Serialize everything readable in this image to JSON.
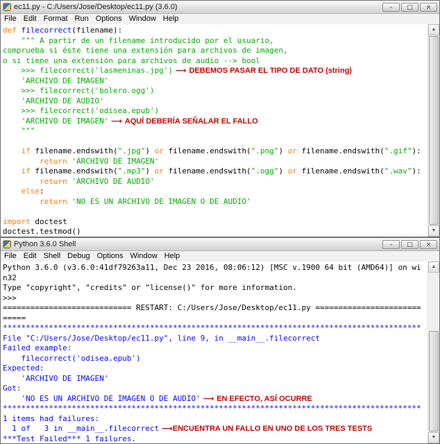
{
  "colors": {
    "keyword": "#FF7700",
    "definition": "#0000FF",
    "string": "#00AA00",
    "plain": "#000000",
    "console": "#000000",
    "stdout": "#0000FF",
    "annotation": "#C00000"
  },
  "chrome": {
    "minimize": "–",
    "maximize": "□",
    "close": "×",
    "scroll_up": "▲",
    "scroll_down": "▼"
  },
  "editor": {
    "title": "ec11.py - C:/Users/Jose/Desktop/ec11.py (3.6.0)",
    "menus": [
      "File",
      "Edit",
      "Format",
      "Run",
      "Options",
      "Window",
      "Help"
    ],
    "lines": [
      [
        {
          "t": "def ",
          "c": "kw"
        },
        {
          "t": "filecorrect",
          "c": "fn"
        },
        {
          "t": "(filename):",
          "c": "pl"
        }
      ],
      [
        {
          "t": "    \"\"\" A partir de un filename introducido por el usuario,",
          "c": "str"
        }
      ],
      [
        {
          "t": "comprueba si éste tiene una extensión para archivos de imagen,",
          "c": "str"
        }
      ],
      [
        {
          "t": "o si tiene una extensión para archivos de audio --> bool",
          "c": "str"
        }
      ],
      [
        {
          "t": "    >>> filecorrect('lasmeninas.jpg')",
          "c": "str"
        },
        {
          "t": " ⟶ ",
          "c": "arr"
        },
        {
          "t": "DEBEMOS PASAR EL TIPO DE DATO (string)",
          "c": "ann"
        }
      ],
      [
        {
          "t": "    'ARCHIVO DE IMAGEN'",
          "c": "str"
        }
      ],
      [
        {
          "t": "    >>> filecorrect('bolero.ogg')",
          "c": "str"
        }
      ],
      [
        {
          "t": "    'ARCHIVO DE AUDIO'",
          "c": "str"
        }
      ],
      [
        {
          "t": "    >>> filecorrect('odisea.epub')",
          "c": "str"
        }
      ],
      [
        {
          "t": "    'ARCHIVO DE IMAGEN'",
          "c": "str"
        },
        {
          "t": " ⟶ ",
          "c": "arr"
        },
        {
          "t": "AQUÍ DEBERÍA SEÑALAR EL FALLO",
          "c": "ann"
        }
      ],
      [
        {
          "t": "    \"\"\"",
          "c": "str"
        }
      ],
      [
        {
          "t": "",
          "c": "pl"
        }
      ],
      [
        {
          "t": "    ",
          "c": "pl"
        },
        {
          "t": "if",
          "c": "kw"
        },
        {
          "t": " filename.endswith(",
          "c": "pl"
        },
        {
          "t": "\".jpg\"",
          "c": "str"
        },
        {
          "t": ") ",
          "c": "pl"
        },
        {
          "t": "or",
          "c": "kw"
        },
        {
          "t": " filename.endswith(",
          "c": "pl"
        },
        {
          "t": "\".png\"",
          "c": "str"
        },
        {
          "t": ") ",
          "c": "pl"
        },
        {
          "t": "or",
          "c": "kw"
        },
        {
          "t": " filename.endswith(",
          "c": "pl"
        },
        {
          "t": "\".gif\"",
          "c": "str"
        },
        {
          "t": "):",
          "c": "pl"
        }
      ],
      [
        {
          "t": "        ",
          "c": "pl"
        },
        {
          "t": "return",
          "c": "kw"
        },
        {
          "t": " ",
          "c": "pl"
        },
        {
          "t": "'ARCHIVO DE IMAGEN'",
          "c": "str"
        }
      ],
      [
        {
          "t": "    ",
          "c": "pl"
        },
        {
          "t": "if",
          "c": "kw"
        },
        {
          "t": " filename.endswith(",
          "c": "pl"
        },
        {
          "t": "\".mp3\"",
          "c": "str"
        },
        {
          "t": ") ",
          "c": "pl"
        },
        {
          "t": "or",
          "c": "kw"
        },
        {
          "t": " filename.endswith(",
          "c": "pl"
        },
        {
          "t": "\".ogg\"",
          "c": "str"
        },
        {
          "t": ") ",
          "c": "pl"
        },
        {
          "t": "or",
          "c": "kw"
        },
        {
          "t": " filename.endswith(",
          "c": "pl"
        },
        {
          "t": "\".wav\"",
          "c": "str"
        },
        {
          "t": "):",
          "c": "pl"
        }
      ],
      [
        {
          "t": "        ",
          "c": "pl"
        },
        {
          "t": "return",
          "c": "kw"
        },
        {
          "t": " ",
          "c": "pl"
        },
        {
          "t": "'ARCHIVO DE AUDIO'",
          "c": "str"
        }
      ],
      [
        {
          "t": "    ",
          "c": "pl"
        },
        {
          "t": "else",
          "c": "kw"
        },
        {
          "t": ":",
          "c": "pl"
        }
      ],
      [
        {
          "t": "        ",
          "c": "pl"
        },
        {
          "t": "return",
          "c": "kw"
        },
        {
          "t": " ",
          "c": "pl"
        },
        {
          "t": "'NO ES UN ARCHIVO DE IMAGEN O DE AUDIO'",
          "c": "str"
        }
      ],
      [
        {
          "t": "",
          "c": "pl"
        }
      ],
      [
        {
          "t": "import",
          "c": "kw"
        },
        {
          "t": " doctest",
          "c": "pl"
        }
      ],
      [
        {
          "t": "doctest.testmod()",
          "c": "pl"
        }
      ]
    ]
  },
  "shell": {
    "title": "Python 3.6.0 Shell",
    "menus": [
      "File",
      "Edit",
      "Shell",
      "Debug",
      "Options",
      "Window",
      "Help"
    ],
    "lines": [
      [
        {
          "t": "Python 3.6.0 (v3.6.0:41df79263a11, Dec 23 2016, 08:06:12) [MSC v.1900 64 bit (AMD64)] on wi",
          "c": "con"
        }
      ],
      [
        {
          "t": "n32",
          "c": "con"
        }
      ],
      [
        {
          "t": "Type \"copyright\", \"credits\" or \"license()\" for more information.",
          "c": "con"
        }
      ],
      [
        {
          "t": ">>> ",
          "c": "con"
        }
      ],
      [
        {
          "t": "============================ RESTART: C:/Users/Jose/Desktop/ec11.py =======================",
          "c": "con"
        }
      ],
      [
        {
          "t": "=====",
          "c": "con"
        }
      ],
      [
        {
          "t": "*******************************************************************************************",
          "c": "out"
        }
      ],
      [
        {
          "t": "File \"C:/Users/Jose/Desktop/ec11.py\", line 9, in __main__.filecorrect",
          "c": "out"
        }
      ],
      [
        {
          "t": "Failed example:",
          "c": "out"
        }
      ],
      [
        {
          "t": "    filecorrect('odisea.epub')",
          "c": "out"
        }
      ],
      [
        {
          "t": "Expected:",
          "c": "out"
        }
      ],
      [
        {
          "t": "    'ARCHIVO DE IMAGEN'",
          "c": "out"
        }
      ],
      [
        {
          "t": "Got:",
          "c": "out"
        }
      ],
      [
        {
          "t": "    'NO ES UN ARCHIVO DE IMAGEN O DE AUDIO'",
          "c": "out"
        },
        {
          "t": " ⟶ ",
          "c": "arr"
        },
        {
          "t": "EN EFECTO, ASÍ OCURRE",
          "c": "ann"
        }
      ],
      [
        {
          "t": "*******************************************************************************************",
          "c": "out"
        }
      ],
      [
        {
          "t": "1 items had failures:",
          "c": "out"
        }
      ],
      [
        {
          "t": "  1 of   3 in __main__.filecorrect",
          "c": "out"
        },
        {
          "t": " ⟶",
          "c": "arr"
        },
        {
          "t": "ENCUENTRA UN FALLO EN UNO DE LOS TRES TESTS",
          "c": "ann"
        }
      ],
      [
        {
          "t": "***Test Failed*** 1 failures.",
          "c": "out"
        }
      ]
    ]
  }
}
